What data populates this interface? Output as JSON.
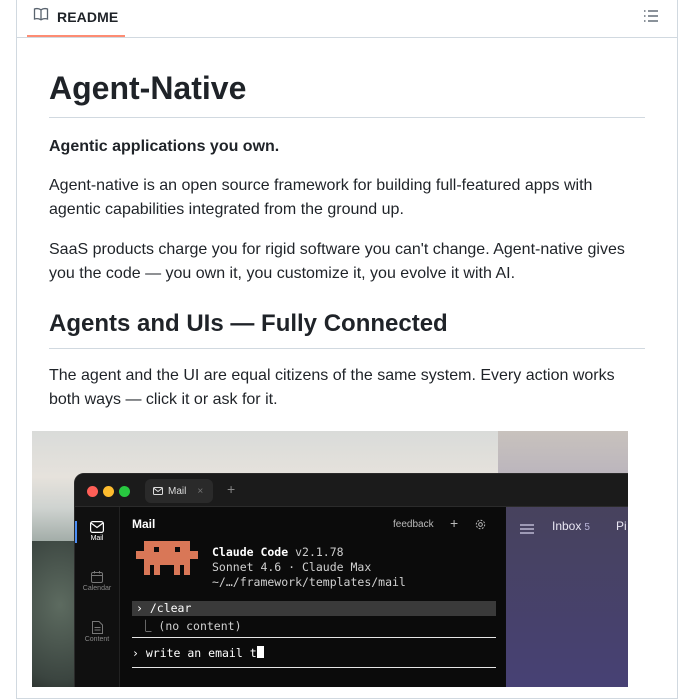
{
  "readme": {
    "tab_label": "README",
    "title": "Agent-Native",
    "tagline": "Agentic applications you own.",
    "para1": "Agent-native is an open source framework for building full-featured apps with agentic capabilities integrated from the ground up.",
    "para2": "SaaS products charge you for rigid software you can't change. Agent-native gives you the code — you own it, you customize it, you evolve it with AI.",
    "h2": "Agents and UIs — Fully Connected",
    "para3": "The agent and the UI are equal citizens of the same system. Every action works both ways — click it or ask for it."
  },
  "screenshot": {
    "tab_label": "Mail",
    "tab_close": "×",
    "new_tab": "+",
    "rail": [
      {
        "label": "Mail"
      },
      {
        "label": "Calendar"
      },
      {
        "label": "Content"
      }
    ],
    "panel_title": "Mail",
    "feedback": "feedback",
    "panel_plus": "+",
    "cc_name": "Claude Code",
    "cc_version": "v2.1.78",
    "cc_model": "Sonnet 4.6 · Claude Max",
    "cc_path": "~/…/framework/templates/mail",
    "cmd_clear": "› /clear",
    "cmd_result": "⎿  (no content)",
    "prompt_text": "› write an email t",
    "inbox_label": "Inbox",
    "inbox_count": "5",
    "inbox_next": "Pi"
  },
  "colors": {
    "accent_tab": "#fd8c73",
    "mascot": "#d97757",
    "dot_red": "#ff5f57",
    "dot_yellow": "#febc2e",
    "dot_green": "#28c840"
  }
}
